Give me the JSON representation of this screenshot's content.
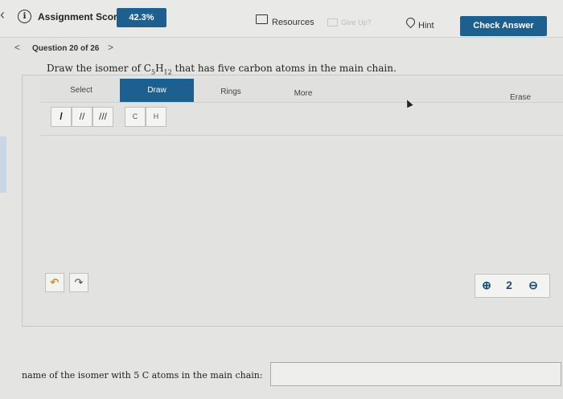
{
  "header": {
    "back_glyph": "‹",
    "score_label": "Assignment Score:",
    "score_value": "42.3%",
    "resources_label": "Resources",
    "giveup_label": "Give Up?",
    "hint_label": "Hint",
    "check_label": "Check Answer"
  },
  "question": {
    "nav_prev": "<",
    "label": "Question 20 of 26",
    "nav_next": ">",
    "text_before": "Draw the isomer of C",
    "sub1": "5",
    "mid": "H",
    "sub2": "12",
    "text_after": " that has five carbon atoms in the main chain."
  },
  "editor": {
    "tabs": [
      "Select",
      "Draw",
      "Rings",
      "More",
      "Erase"
    ],
    "bond_single": "/",
    "bond_double": "//",
    "bond_triple": "///",
    "atom_c": "C",
    "atom_h": "H",
    "undo_glyph": "↶",
    "redo_glyph": "↷",
    "zoom_in_glyph": "⊕",
    "zoom_reset_glyph": "2",
    "zoom_out_glyph": "⊖"
  },
  "answer": {
    "label": "name of the isomer with 5 C atoms in the main chain:",
    "value": ""
  },
  "colors": {
    "accent": "#1d5f8e"
  }
}
